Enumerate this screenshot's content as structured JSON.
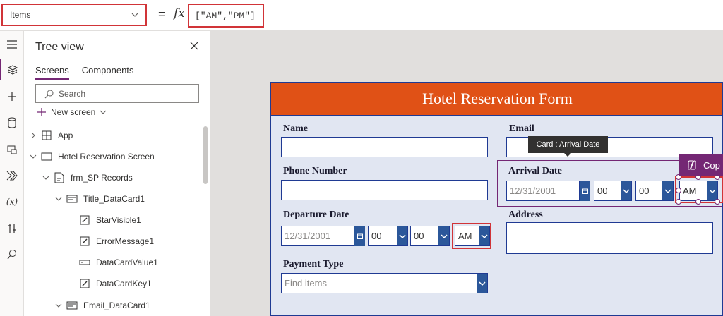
{
  "formula_bar": {
    "property": "Items",
    "equals": "=",
    "fx": "fx",
    "formula": "[\"AM\",\"PM\"]"
  },
  "tree": {
    "title": "Tree view",
    "tabs": [
      "Screens",
      "Components"
    ],
    "search_placeholder": "Search",
    "new_screen": "New screen",
    "nodes": [
      {
        "label": "App",
        "icon": "app-icon"
      },
      {
        "label": "Hotel Reservation Screen",
        "icon": "screen-icon"
      },
      {
        "label": "frm_SP Records",
        "icon": "form-icon"
      },
      {
        "label": "Title_DataCard1",
        "icon": "card-icon"
      },
      {
        "label": "StarVisible1",
        "icon": "edit-label-icon"
      },
      {
        "label": "ErrorMessage1",
        "icon": "edit-label-icon"
      },
      {
        "label": "DataCardValue1",
        "icon": "text-input-icon"
      },
      {
        "label": "DataCardKey1",
        "icon": "edit-label-icon"
      },
      {
        "label": "Email_DataCard1",
        "icon": "card-icon"
      }
    ]
  },
  "form": {
    "title": "Hotel Reservation Form",
    "fields": {
      "name": "Name",
      "email": "Email",
      "phone": "Phone Number",
      "arrival": "Arrival Date",
      "departure": "Departure Date",
      "address": "Address",
      "payment": "Payment Type"
    },
    "date_placeholder": "12/31/2001",
    "hour": "00",
    "minute": "00",
    "ampm": "AM",
    "payment_placeholder": "Find items"
  },
  "tooltip": "Card : Arrival Date",
  "copilot_label": "Cop",
  "colors": {
    "accent": "#742774",
    "header": "#e05116",
    "highlight": "#d13438",
    "control_blue": "#2b579a"
  }
}
